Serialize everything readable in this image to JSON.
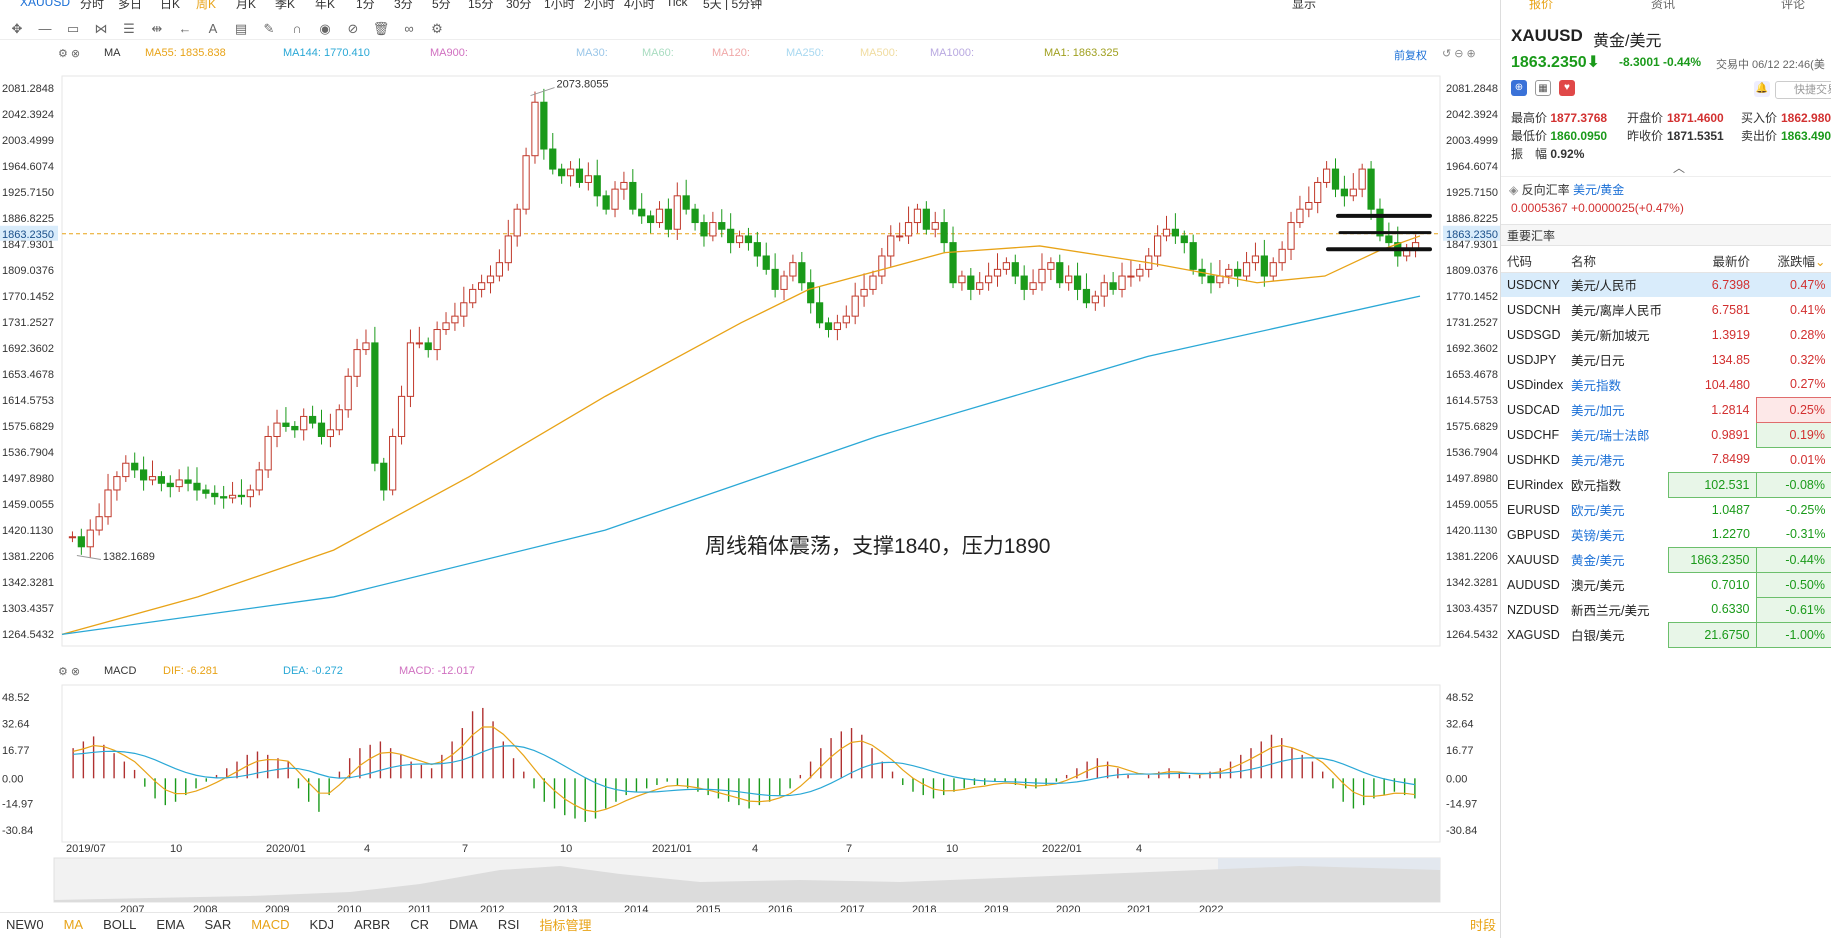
{
  "top_tabs": [
    "XAUUSD",
    "分时",
    "多日",
    "日K",
    "周K",
    "月K",
    "季K",
    "年K",
    "1分",
    "3分",
    "5分",
    "15分",
    "30分",
    "1小时",
    "2小时",
    "4小时",
    "Tick",
    "5天 | 5分钟",
    "显示"
  ],
  "indicator_bar": {
    "name": "MA",
    "ma55": "MA55: 1835.838",
    "ma144": "MA144: 1770.410",
    "ma900": "MA900:",
    "ma30": "MA30:",
    "ma60": "MA60:",
    "ma120": "MA120:",
    "ma250": "MA250:",
    "ma500": "MA500:",
    "ma1000": "MA1000:",
    "ma1": "MA1: 1863.325",
    "adjust": "前复权"
  },
  "macd_bar": {
    "name": "MACD",
    "dif": "DIF: -6.281",
    "dea": "DEA: -0.272",
    "macd": "MACD: -12.017"
  },
  "price_axis": [
    "2081.2848",
    "2042.3924",
    "2003.4999",
    "1964.6074",
    "1925.7150",
    "1886.8225",
    "1847.9301",
    "1809.0376",
    "1770.1452",
    "1731.2527",
    "1692.3602",
    "1653.4678",
    "1614.5753",
    "1575.6829",
    "1536.7904",
    "1497.8980",
    "1459.0055",
    "1420.1130",
    "1381.2206",
    "1342.3281",
    "1303.4357",
    "1264.5432"
  ],
  "current_price_tag": "1863.2350",
  "high_label": "2073.8055",
  "low_label": "1382.1689",
  "annotation": "周线箱体震荡，支撑1840，压力1890",
  "macd_axis": [
    "48.52",
    "32.64",
    "16.77",
    "0.00",
    "-14.97",
    "-30.84"
  ],
  "time_axis": [
    "2019/07",
    "10",
    "2020/01",
    "4",
    "7",
    "10",
    "2021/01",
    "4",
    "7",
    "10",
    "2022/01",
    "4"
  ],
  "overview_years": [
    "2007",
    "2008",
    "2009",
    "2010",
    "2011",
    "2012",
    "2013",
    "2014",
    "2015",
    "2016",
    "2017",
    "2018",
    "2019",
    "2020",
    "2021",
    "2022"
  ],
  "bottom_indicators": [
    "NEW0",
    "MA",
    "BOLL",
    "EMA",
    "SAR",
    "MACD",
    "KDJ",
    "ARBR",
    "CR",
    "DMA",
    "RSI",
    "指标管理"
  ],
  "bottom_right": "时段",
  "right_tabs": [
    "报价",
    "资讯",
    "评论"
  ],
  "quote": {
    "symbol": "XAUUSD",
    "name": "黄金/美元",
    "price": "1863.2350",
    "change": "-8.3001",
    "change_pct": "-0.44%",
    "trade_time": "交易中 06/12 22:46(美",
    "quick_trade": "快捷交易",
    "high_label": "最高价",
    "high": "1877.3768",
    "open_label": "开盘价",
    "open": "1871.4600",
    "bid_label": "买入价",
    "bid": "1862.980",
    "low_label": "最低价",
    "low": "1860.0950",
    "prev_label": "昨收价",
    "prev": "1871.5351",
    "ask_label": "卖出价",
    "ask": "1863.490",
    "amp_label": "振　幅",
    "amp": "0.92%"
  },
  "reverse": {
    "label": "反向汇率",
    "pair": "美元/黄金",
    "value": "0.0005367",
    "change": "+0.0000025(+0.47%)"
  },
  "rates_title": "重要汇率",
  "rates_headers": [
    "代码",
    "名称",
    "最新价",
    "涨跌幅"
  ],
  "rates": [
    {
      "code": "USDCNY",
      "name": "美元/人民币",
      "last": "6.7398",
      "pct": "0.47%",
      "dir": "up",
      "selected": true
    },
    {
      "code": "USDCNH",
      "name": "美元/离岸人民币",
      "last": "6.7581",
      "pct": "0.41%",
      "dir": "up"
    },
    {
      "code": "USDSGD",
      "name": "美元/新加坡元",
      "last": "1.3919",
      "pct": "0.28%",
      "dir": "up"
    },
    {
      "code": "USDJPY",
      "name": "美元/日元",
      "last": "134.85",
      "pct": "0.32%",
      "dir": "up"
    },
    {
      "code": "USDindex",
      "name": "美元指数",
      "last": "104.480",
      "pct": "0.27%",
      "dir": "up"
    },
    {
      "code": "USDCAD",
      "name": "美元/加元",
      "last": "1.2814",
      "pct": "0.25%",
      "dir": "up",
      "box_pct": true
    },
    {
      "code": "USDCHF",
      "name": "美元/瑞士法郎",
      "last": "0.9891",
      "pct": "0.19%",
      "dir": "up",
      "box_pct_g": true
    },
    {
      "code": "USDHKD",
      "name": "美元/港元",
      "last": "7.8499",
      "pct": "0.01%",
      "dir": "up"
    },
    {
      "code": "EURindex",
      "name": "欧元指数",
      "last": "102.531",
      "pct": "-0.08%",
      "dir": "down",
      "box_last": true,
      "box_pct": true
    },
    {
      "code": "EURUSD",
      "name": "欧元/美元",
      "last": "1.0487",
      "pct": "-0.25%",
      "dir": "down"
    },
    {
      "code": "GBPUSD",
      "name": "英镑/美元",
      "last": "1.2270",
      "pct": "-0.31%",
      "dir": "down"
    },
    {
      "code": "XAUUSD",
      "name": "黄金/美元",
      "last": "1863.2350",
      "pct": "-0.44%",
      "dir": "down",
      "box_last": true,
      "box_pct": true
    },
    {
      "code": "AUDUSD",
      "name": "澳元/美元",
      "last": "0.7010",
      "pct": "-0.50%",
      "dir": "down",
      "box_pct": true
    },
    {
      "code": "NZDUSD",
      "name": "新西兰元/美元",
      "last": "0.6330",
      "pct": "-0.61%",
      "dir": "down",
      "box_pct": true
    },
    {
      "code": "XAGUSD",
      "name": "白银/美元",
      "last": "21.6750",
      "pct": "-1.00%",
      "dir": "down",
      "box_last": true,
      "box_pct": true
    }
  ]
}
